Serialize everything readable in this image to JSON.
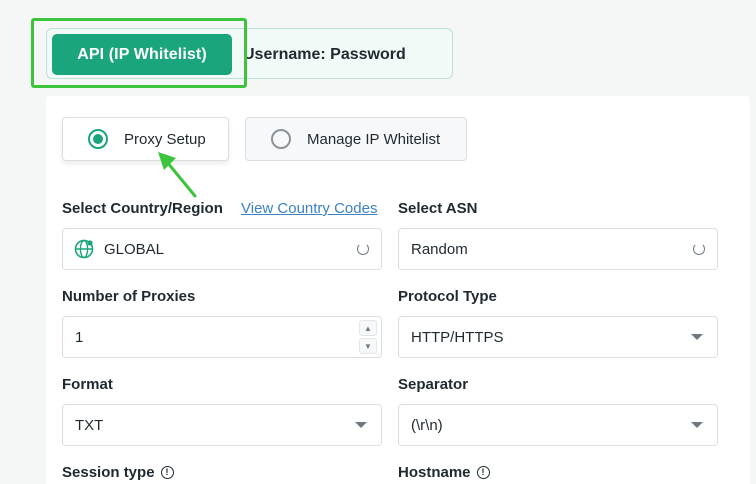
{
  "auth_tabs": {
    "api_label": "API (IP Whitelist)",
    "user_label": "Username: Password"
  },
  "mode_options": {
    "proxy_setup": "Proxy Setup",
    "manage_whitelist": "Manage IP Whitelist"
  },
  "form": {
    "country": {
      "label": "Select Country/Region",
      "link": "View Country Codes",
      "value": "GLOBAL"
    },
    "asn": {
      "label": "Select ASN",
      "value": "Random"
    },
    "proxies": {
      "label": "Number of Proxies",
      "value": "1"
    },
    "protocol": {
      "label": "Protocol Type",
      "value": "HTTP/HTTPS"
    },
    "format": {
      "label": "Format",
      "value": "TXT"
    },
    "separator": {
      "label": "Separator",
      "value": "(\\r\\n)"
    },
    "session_type": {
      "label": "Session type"
    },
    "hostname": {
      "label": "Hostname"
    }
  },
  "colors": {
    "accent": "#1aa57c",
    "highlight": "#3cc43c",
    "link": "#3b82c4"
  }
}
